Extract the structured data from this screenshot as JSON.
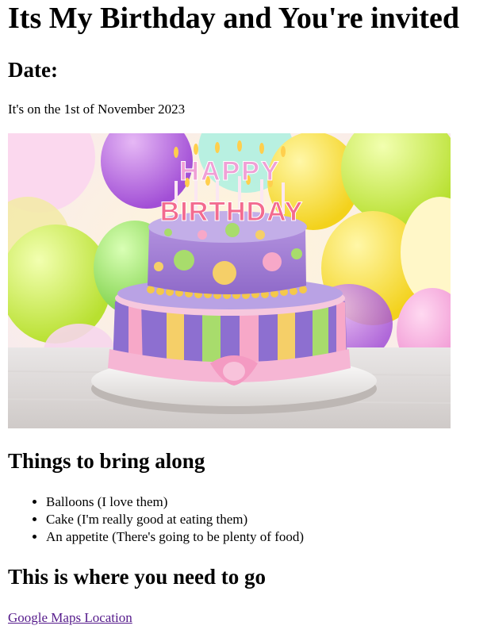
{
  "page": {
    "title": "Its My Birthday and You're invited",
    "date_heading": "Date:",
    "date_text": "It's on the 1st of November 2023",
    "image": {
      "icon": "birthday-cake-photo",
      "cake_topper_line1": "HAPPY",
      "cake_topper_line2": "BIRTHDAY"
    },
    "bring_heading": "Things to bring along",
    "bring_items": [
      "Balloons (I love them)",
      "Cake (I'm really good at eating them)",
      "An appetite (There's going to be plenty of food)"
    ],
    "where_heading": "This is where you need to go",
    "maps_link_label": "Google Maps Location",
    "link_color": "#551a8b"
  }
}
